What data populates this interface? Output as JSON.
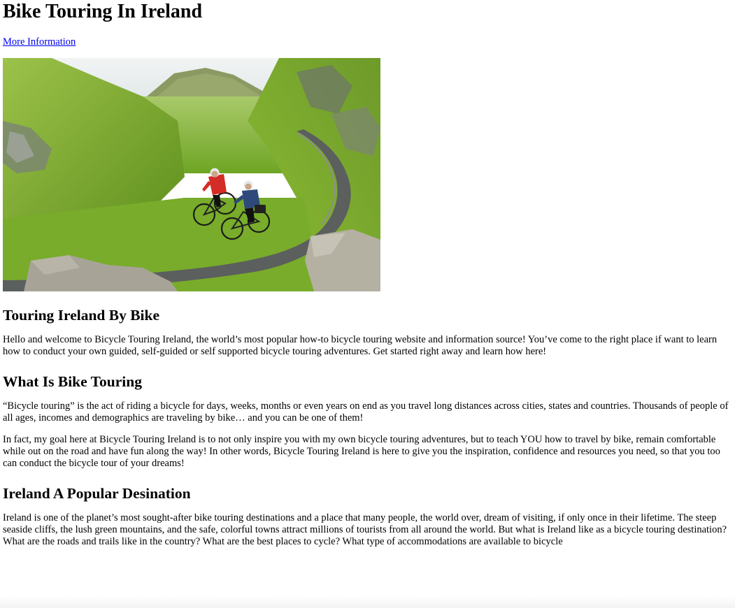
{
  "page": {
    "title": "Bike Touring In Ireland",
    "more_info_link": "More Information"
  },
  "sections": [
    {
      "heading": "Touring Ireland By Bike",
      "paragraphs": [
        "Hello and welcome to Bicycle Touring Ireland, the world’s most popular how-to bicycle touring website and information source! You’ve come to the right place if want to learn how to conduct your own guided, self-guided or self supported bicycle touring adventures. Get started right away and learn how here!"
      ]
    },
    {
      "heading": "What Is Bike Touring",
      "paragraphs": [
        "“Bicycle touring” is the act of riding a bicycle for days, weeks, months or even years on end as you travel long distances across cities, states and countries. Thousands of people of all ages, incomes and demographics are traveling by bike… and you can be one of them!",
        "In fact, my goal here at Bicycle Touring Ireland is to not only inspire you with my own bicycle touring adventures, but to teach YOU how to travel by bike, remain comfortable while out on the road and have fun along the way! In other words, Bicycle Touring Ireland is here to give you the inspiration, confidence and resources you need, so that you too can conduct the bicycle tour of your dreams!"
      ]
    },
    {
      "heading": "Ireland A Popular Desination",
      "paragraphs": [
        "Ireland is one of the planet’s most sought-after bike touring destinations and a place that many people, the world over, dream of visiting, if only once in their lifetime. The steep seaside cliffs, the lush green mountains, and the safe, colorful towns attract millions of tourists from all around the world. But what is Ireland like as a bicycle touring destination? What are the roads and trails like in the country? What are the best places to cycle? What type of accommodations are available to bicycle"
      ]
    }
  ],
  "hero_image": {
    "icon": "two-cyclists-mountain-road-photo",
    "colors": {
      "sky": "#e9eef0",
      "grass": "#7fb52c",
      "road": "#5b5f5e",
      "jersey_red": "#d42c26",
      "jersey_blue": "#2d4a7a"
    }
  }
}
